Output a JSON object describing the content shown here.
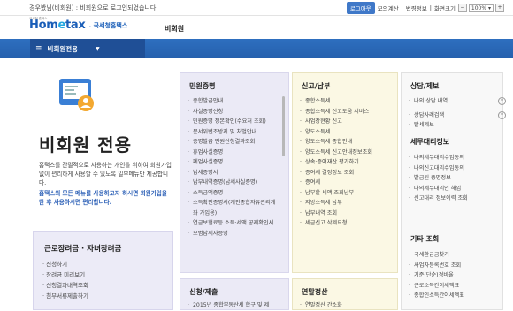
{
  "topbar": {
    "login_msg": "경우봤님(비회원) : 비회원으로 로그인되었습니다.",
    "login_button": "로그아웃",
    "links": [
      "모의계산",
      "법령정보",
      "화면크기"
    ],
    "zoom_value": "100%"
  },
  "header": {
    "logo_home": "Hom",
    "logo_e": "e",
    "logo_tax": "tax",
    "logo_sub": ". 국세청홈택스",
    "tiny": "국세청 홈택스",
    "title": "비회원"
  },
  "nav": {
    "menu_label": "비회원전용"
  },
  "hero": {
    "title": "비회원 전용",
    "desc": "홈택스를 간필적으로 사용하는 개인을 위하여 회원가입 없이 편리하게 사용할 수 있도록 일부메뉴만 제공합니다.",
    "desc2": "홈택스의 모든 메뉴를 사용하고자 하시면 회원가입을 한 후 사용하시면 편리합니다."
  },
  "panel_left": {
    "title": "근로장려금 · 자녀장려금",
    "items": [
      "· 신청하기",
      "· 장려금 미리보기",
      "· 신청결과내역조회",
      "· 첨부서류제출하기"
    ]
  },
  "col1": {
    "title": "민원증명",
    "items": [
      "종합발급안내",
      "사실증명신청",
      "민원증명 정본확인(수요처 조회)",
      "문서위변조방지 및 처벌안내",
      "증명발급 민원신청결과조회",
      "휴업사실증명",
      "폐업사실증명",
      "납세증명서",
      "납부내역증명(납세사실증명)",
      "소득금액증명",
      "소득확인증명서(개인종합자유관리계좌 가입용)",
      "연금보험료등 소득·세액 공제확인서",
      "모범납세자증명"
    ]
  },
  "col1b": {
    "title": "신청/제출",
    "items": [
      "2015년 종합부동산세 합구 및 제"
    ]
  },
  "col2": {
    "title": "신고/납부",
    "items": [
      "종합소득세",
      "종합소득세 신고도움 서비스",
      "사업장현황 신고",
      "양도소득세",
      "양도소득세 종합안내",
      "양도소득세 신고안내정보조회",
      "상속·증여재산 평가하기",
      "증여세 결정정보 조회",
      "증여세",
      "납부할 세액 조회납부",
      "지방소득세 납부",
      "납부내역 조회",
      "세금신고 삭제요청"
    ]
  },
  "col2b": {
    "title": "연말정산",
    "items": [
      "연말정산 간소화"
    ]
  },
  "col3": {
    "title": "상담/제보",
    "items": [
      "나의 상담 내역",
      "상담사례검색",
      "탈세제보"
    ],
    "title2": "세무대리정보",
    "items2": [
      "나의세무대리수임동의",
      "나의신고대리수임동의",
      "발급된 증명정보",
      "나의세무대리인 해임",
      "신고대리 정보이력 조회"
    ],
    "title3": "기타 조회",
    "items3": [
      "국세환급금찾기",
      "사업자등록번호 조회",
      "기준(단순)경비율",
      "근로소득간이세액표",
      "종합인소득간이세액표"
    ]
  },
  "colors": {
    "nav_blue": "#2560ad",
    "menu_dark": "#1f4f96",
    "accent_link": "#2b5fb6"
  }
}
